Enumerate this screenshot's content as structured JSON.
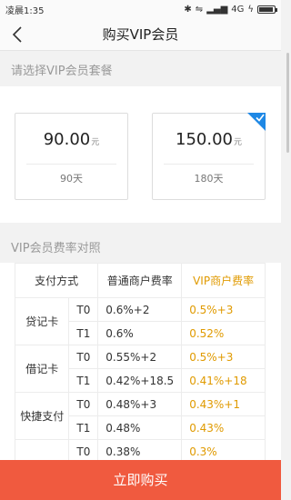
{
  "status": {
    "time": "凌晨1:35",
    "network": "4G",
    "icons": [
      "bluetooth-icon",
      "vibrate-icon",
      "signal-icon",
      "charging-icon",
      "battery-icon"
    ],
    "battery_level": 0.95
  },
  "header": {
    "title": "购买VIP会员",
    "back_icon": "chevron-left-icon"
  },
  "plans_section": {
    "label": "请选择VIP会员套餐",
    "plans": [
      {
        "price": "90.00",
        "unit": "元",
        "days": "90天",
        "selected": false
      },
      {
        "price": "150.00",
        "unit": "元",
        "days": "180天",
        "selected": true
      }
    ]
  },
  "rates_section": {
    "label": "VIP会员费率对照",
    "headers": {
      "method": "支付方式",
      "normal": "普通商户费率",
      "vip": "VIP商户费率"
    },
    "rows": [
      {
        "method": "贷记卡",
        "items": [
          {
            "t": "T0",
            "normal": "0.6%+2",
            "vip": "0.5%+3"
          },
          {
            "t": "T1",
            "normal": "0.6%",
            "vip": "0.52%"
          }
        ]
      },
      {
        "method": "借记卡",
        "items": [
          {
            "t": "T0",
            "normal": "0.55%+2",
            "vip": "0.5%+3"
          },
          {
            "t": "T1",
            "normal": "0.42%+18.5",
            "vip": "0.41%+18"
          }
        ]
      },
      {
        "method": "快捷支付",
        "items": [
          {
            "t": "T0",
            "normal": "0.48%+3",
            "vip": "0.43%+1"
          },
          {
            "t": "T1",
            "normal": "0.48%",
            "vip": "0.43%"
          }
        ]
      },
      {
        "method": "",
        "items": [
          {
            "t": "T0",
            "normal": "0.38%",
            "vip": "0.3%"
          }
        ]
      }
    ]
  },
  "footer": {
    "buy_label": "立即购买"
  },
  "colors": {
    "accent": "#f05a3f",
    "vip": "#e09a00",
    "check": "#1e88e5"
  }
}
